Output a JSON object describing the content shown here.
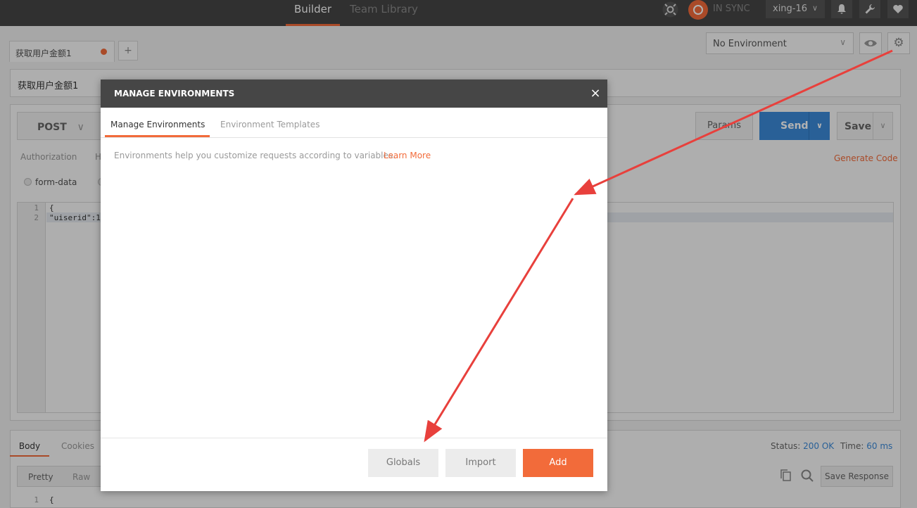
{
  "topbar": {
    "nav_builder": "Builder",
    "nav_team_library": "Team Library",
    "sync_status": "IN SYNC",
    "user": "xing-16"
  },
  "request_tab": {
    "label": "获取用户金额1",
    "add_label": "+"
  },
  "environment": {
    "selected": "No Environment"
  },
  "request": {
    "name": "获取用户金额1",
    "method": "POST",
    "params_label": "Params",
    "send_label": "Send",
    "save_label": "Save",
    "auth_tab": "Authorization",
    "header_tab_partial": "H",
    "generate_code": "Generate Code",
    "body_mode": "form-data",
    "editor_lines": [
      {
        "num": "1",
        "text": "{"
      },
      {
        "num": "2",
        "text": "\"uiserid\":1"
      }
    ]
  },
  "response": {
    "tabs": [
      "Body",
      "Cookies"
    ],
    "status_label": "Status:",
    "status_value": "200 OK",
    "time_label": "Time:",
    "time_value": "60 ms",
    "view_pretty": "Pretty",
    "view_raw": "Raw",
    "save_response": "Save Response",
    "line1_num": "1",
    "line1_text": "{"
  },
  "modal": {
    "title": "MANAGE ENVIRONMENTS",
    "close": "×",
    "tabs": [
      "Manage Environments",
      "Environment Templates"
    ],
    "description": "Environments help you customize requests according to variables.",
    "learn_more": "Learn More",
    "buttons": {
      "globals": "Globals",
      "import": "Import",
      "add": "Add"
    }
  },
  "colors": {
    "accent": "#f26b3a",
    "send": "#3b8ad9",
    "topbar": "#464646",
    "arrow": "#e8403c"
  },
  "icons": [
    "radar-icon",
    "sync-icon",
    "chevron-down-icon",
    "bell-icon",
    "wrench-icon",
    "heart-icon",
    "eye-icon",
    "gear-icon",
    "close-icon",
    "copy-icon",
    "search-icon"
  ]
}
